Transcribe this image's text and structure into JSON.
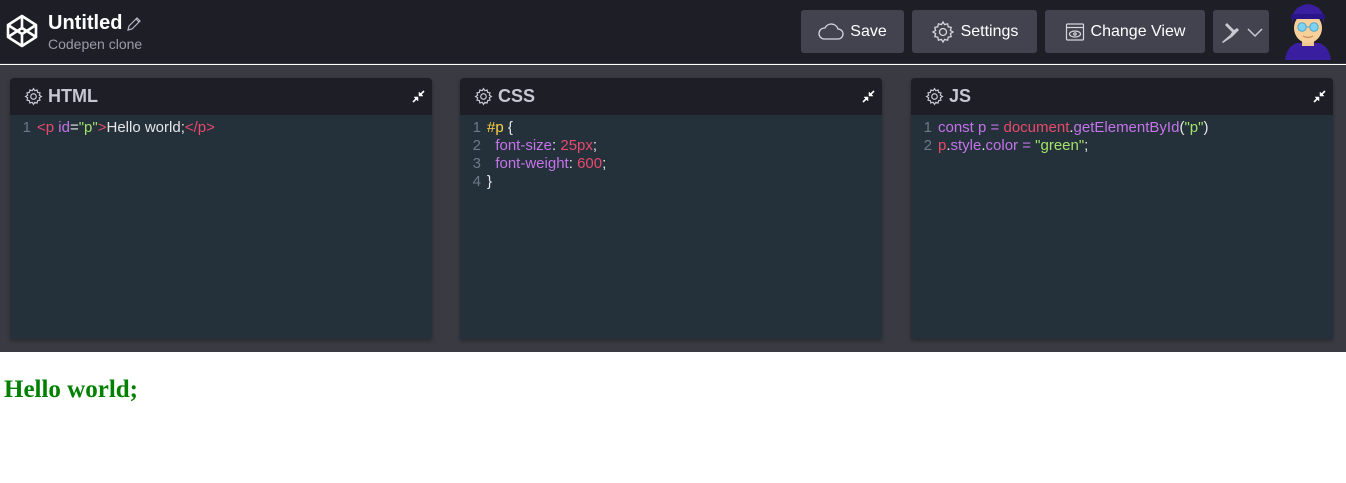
{
  "header": {
    "title": "Untitled",
    "subtitle": "Codepen clone",
    "buttons": {
      "save": "Save",
      "settings": "Settings",
      "change_view": "Change View"
    },
    "icons": {
      "logo": "codepen-logo-icon",
      "edit": "pencil-icon",
      "save": "cloud-icon",
      "settings": "gear-icon",
      "change_view": "window-eye-icon",
      "pin": "pin-icon",
      "dropdown": "chevron-down-icon"
    }
  },
  "panels": {
    "html": {
      "title": "HTML",
      "lines": [
        [
          {
            "t": "<p ",
            "c": "tag"
          },
          {
            "t": "id",
            "c": "attr"
          },
          {
            "t": "=",
            "c": "plain"
          },
          {
            "t": "\"p\"",
            "c": "str"
          },
          {
            "t": ">",
            "c": "tag"
          },
          {
            "t": "Hello world;",
            "c": "plain"
          },
          {
            "t": "</p>",
            "c": "tag"
          }
        ]
      ]
    },
    "css": {
      "title": "CSS",
      "lines": [
        [
          {
            "t": "#p",
            "c": "sel"
          },
          {
            "t": " {",
            "c": "plain"
          }
        ],
        [
          {
            "t": "  font-size",
            "c": "prop"
          },
          {
            "t": ": ",
            "c": "plain"
          },
          {
            "t": "25px",
            "c": "num"
          },
          {
            "t": ";",
            "c": "plain"
          }
        ],
        [
          {
            "t": "  font-weight",
            "c": "prop"
          },
          {
            "t": ": ",
            "c": "plain"
          },
          {
            "t": "600",
            "c": "num"
          },
          {
            "t": ";",
            "c": "plain"
          }
        ],
        [
          {
            "t": "}",
            "c": "plain"
          }
        ]
      ]
    },
    "js": {
      "title": "JS",
      "lines": [
        [
          {
            "t": "const ",
            "c": "kw"
          },
          {
            "t": "p",
            "c": "var"
          },
          {
            "t": " = ",
            "c": "op"
          },
          {
            "t": "document",
            "c": "obj"
          },
          {
            "t": ".",
            "c": "plain"
          },
          {
            "t": "getElementById",
            "c": "fn"
          },
          {
            "t": "(",
            "c": "plain"
          },
          {
            "t": "\"p\"",
            "c": "str"
          },
          {
            "t": ")",
            "c": "plain"
          }
        ],
        [
          {
            "t": "p",
            "c": "obj"
          },
          {
            "t": ".",
            "c": "plain"
          },
          {
            "t": "style",
            "c": "var"
          },
          {
            "t": ".",
            "c": "plain"
          },
          {
            "t": "color",
            "c": "var"
          },
          {
            "t": " = ",
            "c": "op"
          },
          {
            "t": "\"green\"",
            "c": "str"
          },
          {
            "t": ";",
            "c": "plain"
          }
        ]
      ]
    }
  },
  "output": {
    "text": "Hello world;",
    "color": "#008000"
  },
  "colors": {
    "header_bg": "#1e1e26",
    "button_bg": "#43424f",
    "editor_bg": "#24303a",
    "accent_green": "#008000"
  }
}
